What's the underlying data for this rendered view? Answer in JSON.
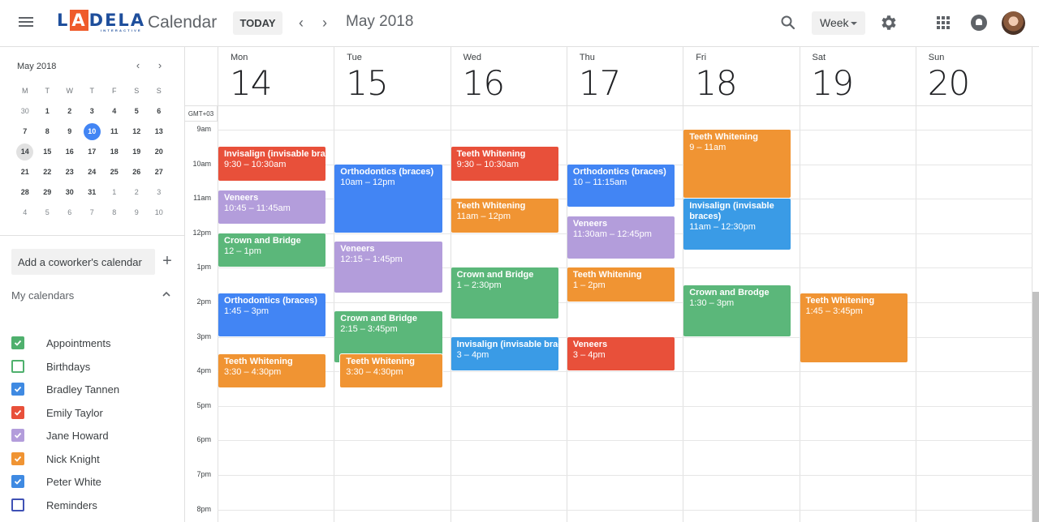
{
  "header": {
    "logo_letters": [
      "L",
      "A",
      "DELA"
    ],
    "logo_subtitle": "INTERACTIVE",
    "app_name": "Calendar",
    "today_label": "TODAY",
    "prev_icon": "‹",
    "next_icon": "›",
    "current_period": "May 2018",
    "view_label": "Week"
  },
  "sidebar": {
    "mini_calendar": {
      "title": "May 2018",
      "prev_icon": "‹",
      "next_icon": "›",
      "weekdays": [
        "M",
        "T",
        "W",
        "T",
        "F",
        "S",
        "S"
      ],
      "weeks": [
        [
          {
            "d": "30",
            "other": true
          },
          {
            "d": "1"
          },
          {
            "d": "2"
          },
          {
            "d": "3"
          },
          {
            "d": "4"
          },
          {
            "d": "5"
          },
          {
            "d": "6"
          }
        ],
        [
          {
            "d": "7"
          },
          {
            "d": "8"
          },
          {
            "d": "9"
          },
          {
            "d": "10",
            "today": true
          },
          {
            "d": "11"
          },
          {
            "d": "12"
          },
          {
            "d": "13"
          }
        ],
        [
          {
            "d": "14",
            "selected": true
          },
          {
            "d": "15"
          },
          {
            "d": "16"
          },
          {
            "d": "17"
          },
          {
            "d": "18"
          },
          {
            "d": "19"
          },
          {
            "d": "20"
          }
        ],
        [
          {
            "d": "21"
          },
          {
            "d": "22"
          },
          {
            "d": "23"
          },
          {
            "d": "24"
          },
          {
            "d": "25"
          },
          {
            "d": "26"
          },
          {
            "d": "27"
          }
        ],
        [
          {
            "d": "28"
          },
          {
            "d": "29"
          },
          {
            "d": "30"
          },
          {
            "d": "31"
          },
          {
            "d": "1",
            "other": true
          },
          {
            "d": "2",
            "other": true
          },
          {
            "d": "3",
            "other": true
          }
        ],
        [
          {
            "d": "4",
            "other": true
          },
          {
            "d": "5",
            "other": true
          },
          {
            "d": "6",
            "other": true
          },
          {
            "d": "7",
            "other": true
          },
          {
            "d": "8",
            "other": true
          },
          {
            "d": "9",
            "other": true
          },
          {
            "d": "10",
            "other": true
          }
        ]
      ]
    },
    "coworker_placeholder": "Add a coworker's calendar",
    "add_icon": "+",
    "my_calendars_label": "My calendars",
    "calendars": [
      {
        "name": "Appointments",
        "color": "#4fb06d",
        "checked": true
      },
      {
        "name": "Birthdays",
        "color": "#4fb06d",
        "checked": false
      },
      {
        "name": "Bradley Tannen",
        "color": "#3f8ae2",
        "checked": true
      },
      {
        "name": "Emily Taylor",
        "color": "#e8503a",
        "checked": true
      },
      {
        "name": "Jane Howard",
        "color": "#b39ddb",
        "checked": true
      },
      {
        "name": "Nick Knight",
        "color": "#f09433",
        "checked": true
      },
      {
        "name": "Peter White",
        "color": "#3f8ae2",
        "checked": true
      },
      {
        "name": "Reminders",
        "color": "#3f51b5",
        "checked": false
      }
    ]
  },
  "week": {
    "timezone_label": "GMT+03",
    "days": [
      {
        "name": "Mon",
        "num": "14"
      },
      {
        "name": "Tue",
        "num": "15"
      },
      {
        "name": "Wed",
        "num": "16"
      },
      {
        "name": "Thu",
        "num": "17"
      },
      {
        "name": "Fri",
        "num": "18"
      },
      {
        "name": "Sat",
        "num": "19"
      },
      {
        "name": "Sun",
        "num": "20"
      }
    ],
    "hours": [
      "9am",
      "10am",
      "11am",
      "12pm",
      "1pm",
      "2pm",
      "3pm",
      "4pm",
      "5pm",
      "6pm",
      "7pm",
      "8pm"
    ],
    "events": [
      {
        "day": 0,
        "start": 9.5,
        "end": 10.5,
        "title": "Invisalign (invisable braces)",
        "time": "9:30 – 10:30am",
        "color": "#e8503a",
        "nowrap": true
      },
      {
        "day": 0,
        "start": 10.75,
        "end": 11.75,
        "title": "Veneers",
        "time": "10:45 – 11:45am",
        "color": "#b39ddb"
      },
      {
        "day": 0,
        "start": 12,
        "end": 13,
        "title": "Crown and Bridge",
        "time": "12 – 1pm",
        "color": "#5bb77a"
      },
      {
        "day": 0,
        "start": 13.75,
        "end": 15,
        "title": "Orthodontics (braces)",
        "time": "1:45 – 3pm",
        "color": "#4285f4"
      },
      {
        "day": 0,
        "start": 15.5,
        "end": 16.5,
        "title": "Teeth Whitening",
        "time": "3:30 – 4:30pm",
        "color": "#f09433"
      },
      {
        "day": 1,
        "start": 10,
        "end": 12,
        "title": "Orthodontics (braces)",
        "time": "10am – 12pm",
        "color": "#4285f4"
      },
      {
        "day": 1,
        "start": 12.25,
        "end": 13.75,
        "title": "Veneers",
        "time": "12:15 – 1:45pm",
        "color": "#b39ddb"
      },
      {
        "day": 1,
        "start": 14.25,
        "end": 15.75,
        "title": "Crown and Bridge",
        "time": "2:15 – 3:45pm",
        "color": "#5bb77a"
      },
      {
        "day": 1,
        "start": 15.5,
        "end": 16.5,
        "title": "Teeth Whitening",
        "time": "3:30 – 4:30pm",
        "color": "#f09433",
        "offset": true
      },
      {
        "day": 2,
        "start": 9.5,
        "end": 10.5,
        "title": "Teeth Whitening",
        "time": "9:30 – 10:30am",
        "color": "#e8503a"
      },
      {
        "day": 2,
        "start": 11,
        "end": 12,
        "title": "Teeth Whitening",
        "time": "11am – 12pm",
        "color": "#f09433"
      },
      {
        "day": 2,
        "start": 13,
        "end": 14.5,
        "title": "Crown and Bridge",
        "time": "1 – 2:30pm",
        "color": "#5bb77a"
      },
      {
        "day": 2,
        "start": 15,
        "end": 16,
        "title": "Invisalign (invisable braces)",
        "time": "3 – 4pm",
        "color": "#3a9be6",
        "nowrap": true
      },
      {
        "day": 3,
        "start": 10,
        "end": 11.25,
        "title": "Orthodontics (braces)",
        "time": "10 – 11:15am",
        "color": "#4285f4"
      },
      {
        "day": 3,
        "start": 11.5,
        "end": 12.75,
        "title": "Veneers",
        "time": "11:30am – 12:45pm",
        "color": "#b39ddb"
      },
      {
        "day": 3,
        "start": 13,
        "end": 14,
        "title": "Teeth Whitening",
        "time": "1 – 2pm",
        "color": "#f09433"
      },
      {
        "day": 3,
        "start": 15,
        "end": 16,
        "title": "Veneers",
        "time": "3 – 4pm",
        "color": "#e8503a"
      },
      {
        "day": 4,
        "start": 9,
        "end": 11,
        "title": "Teeth Whitening",
        "time": "9 – 11am",
        "color": "#f09433"
      },
      {
        "day": 4,
        "start": 11,
        "end": 12.5,
        "title": "Invisalign (invisable braces)",
        "time": "11am – 12:30pm",
        "color": "#3a9be6"
      },
      {
        "day": 4,
        "start": 13.5,
        "end": 15,
        "title": "Crown and Brodge",
        "time": "1:30 – 3pm",
        "color": "#5bb77a"
      },
      {
        "day": 5,
        "start": 13.75,
        "end": 15.75,
        "title": "Teeth Whitening",
        "time": "1:45 – 3:45pm",
        "color": "#f09433"
      }
    ]
  }
}
